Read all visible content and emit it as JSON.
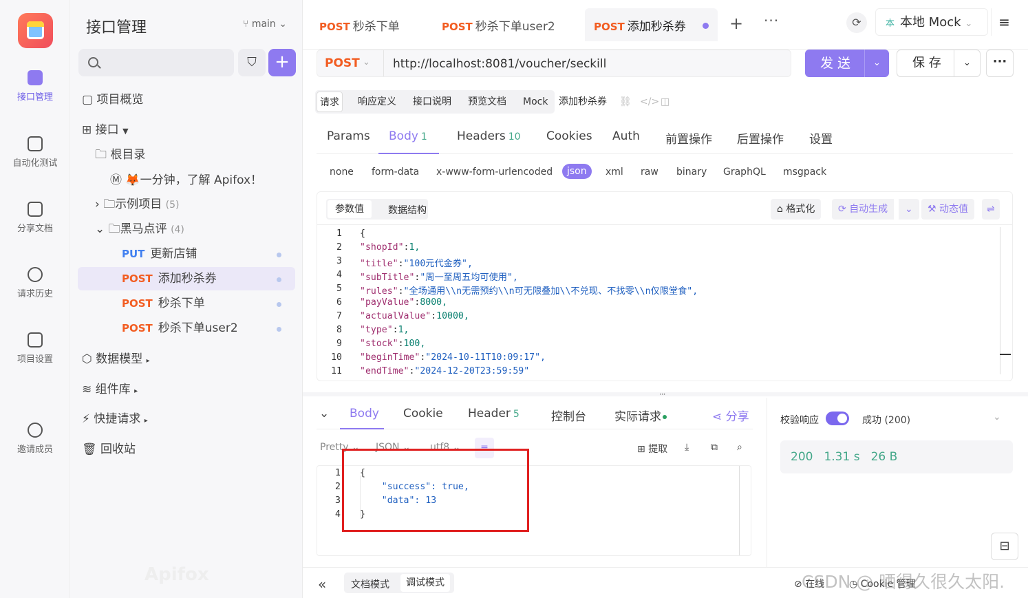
{
  "nav": {
    "items": [
      {
        "label": "接口管理"
      },
      {
        "label": "自动化测试"
      },
      {
        "label": "分享文档"
      },
      {
        "label": "请求历史"
      },
      {
        "label": "项目设置"
      },
      {
        "label": "邀请成员"
      }
    ]
  },
  "tree": {
    "title": "接口管理",
    "branch": "main",
    "overview": "项目概览",
    "api_root": "接口",
    "root_dir": "根目录",
    "intro": "一分钟，了解 Apifox！",
    "examples": "示例项目",
    "examples_count": "(5)",
    "folder": "黑马点评",
    "folder_count": "(4)",
    "endpoints": [
      {
        "method": "PUT",
        "name": "更新店铺"
      },
      {
        "method": "POST",
        "name": "添加秒杀券"
      },
      {
        "method": "POST",
        "name": "秒杀下单"
      },
      {
        "method": "POST",
        "name": "秒杀下单user2"
      }
    ],
    "schemas": "数据模型",
    "components": "组件库",
    "quick": "快捷请求",
    "trash": "回收站",
    "brand": "Apifox"
  },
  "tabs": [
    {
      "method": "POST",
      "name": "秒杀下单"
    },
    {
      "method": "POST",
      "name": "秒杀下单user2"
    },
    {
      "method": "POST",
      "name": "添加秒杀券"
    }
  ],
  "env": {
    "badge": "本",
    "name": "本地 Mock"
  },
  "request": {
    "method": "POST",
    "url": "http://localhost:8081/voucher/seckill",
    "send": "发 送",
    "save": "保 存"
  },
  "subtabs": [
    "请求",
    "响应定义",
    "接口说明",
    "预览文档",
    "Mock",
    "添加秒杀券"
  ],
  "param_tabs": [
    {
      "label": "Params",
      "count": ""
    },
    {
      "label": "Body",
      "count": "1"
    },
    {
      "label": "Headers",
      "count": "10"
    },
    {
      "label": "Cookies",
      "count": ""
    },
    {
      "label": "Auth",
      "count": ""
    },
    {
      "label": "前置操作",
      "count": ""
    },
    {
      "label": "后置操作",
      "count": ""
    },
    {
      "label": "设置",
      "count": ""
    }
  ],
  "body_types": [
    "none",
    "form-data",
    "x-www-form-urlencoded",
    "json",
    "xml",
    "raw",
    "binary",
    "GraphQL",
    "msgpack"
  ],
  "editor": {
    "seg": [
      "参数值",
      "数据结构"
    ],
    "format": "格式化",
    "autogen": "自动生成",
    "dynamic": "动态值",
    "lines": [
      "1",
      "2",
      "3",
      "4",
      "5",
      "6",
      "7",
      "8",
      "9",
      "10",
      "11"
    ],
    "code": [
      {
        "k": "",
        "v": "{"
      },
      {
        "k": "\"shopId\"",
        "v": "1,"
      },
      {
        "k": "\"title\"",
        "v": "\"100元代金券\","
      },
      {
        "k": "\"subTitle\"",
        "v": "\"周一至周五均可使用\","
      },
      {
        "k": "\"rules\"",
        "v": "\"全场通用\\\\n无需预约\\\\n可无限叠加\\\\不兑现、不找零\\\\n仅限堂食\","
      },
      {
        "k": "\"payValue\"",
        "v": "8000,"
      },
      {
        "k": "\"actualValue\"",
        "v": "10000,"
      },
      {
        "k": "\"type\"",
        "v": "1,"
      },
      {
        "k": "\"stock\"",
        "v": "100,"
      },
      {
        "k": "\"beginTime\"",
        "v": "\"2024-10-11T10:09:17\","
      },
      {
        "k": "\"endTime\"",
        "v": "\"2024-12-20T23:59:59\""
      }
    ]
  },
  "response": {
    "tabs": [
      {
        "label": "Body",
        "count": ""
      },
      {
        "label": "Cookie",
        "count": ""
      },
      {
        "label": "Header",
        "count": "5"
      },
      {
        "label": "控制台",
        "count": ""
      },
      {
        "label": "实际请求",
        "count": ""
      }
    ],
    "share": "分享",
    "pretty": "Pretty",
    "json": "JSON",
    "utf8": "utf8",
    "extract": "提取",
    "lines": [
      "1",
      "2",
      "3",
      "4"
    ],
    "body": [
      "{",
      "    \"success\": true,",
      "    \"data\": 13",
      "}"
    ]
  },
  "validate": {
    "label": "校验响应",
    "result": "成功 (200)",
    "status": "200",
    "time": "1.31 s",
    "size": "26 B"
  },
  "bottom": {
    "doc_mode": "文档模式",
    "debug_mode": "调试模式",
    "online": "在线",
    "cookie": "Cookie 管理"
  },
  "watermark": "CSDN @ 晒得久很久太阳.",
  "colors": {
    "accent": "#8e7af0",
    "post": "#f25d22",
    "put": "#4180f0",
    "success": "#45a88a",
    "highlight": "#e02020"
  }
}
